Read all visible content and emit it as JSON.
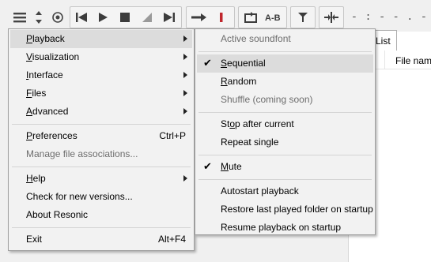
{
  "toolbar": {
    "position_text": "- : - - . -"
  },
  "panel": {
    "tab_label": "List",
    "column_header": "File name"
  },
  "main_menu": {
    "items": [
      {
        "key": "playback",
        "pre": "",
        "u": "P",
        "post": "layback",
        "has_submenu": true
      },
      {
        "key": "visualization",
        "pre": "",
        "u": "V",
        "post": "isualization",
        "has_submenu": true
      },
      {
        "key": "interface",
        "pre": "",
        "u": "I",
        "post": "nterface",
        "has_submenu": true
      },
      {
        "key": "files",
        "pre": "",
        "u": "F",
        "post": "iles",
        "has_submenu": true
      },
      {
        "key": "advanced",
        "pre": "",
        "u": "A",
        "post": "dvanced",
        "has_submenu": true
      },
      {
        "key": "preferences",
        "pre": "",
        "u": "P",
        "post": "references",
        "shortcut": "Ctrl+P"
      },
      {
        "key": "manage",
        "pre": "Manage file associations...",
        "u": "",
        "post": ""
      },
      {
        "key": "help",
        "pre": "",
        "u": "H",
        "post": "elp",
        "has_submenu": true
      },
      {
        "key": "check",
        "pre": "Check for new versions...",
        "u": "",
        "post": ""
      },
      {
        "key": "about",
        "pre": "About Resonic",
        "u": "",
        "post": ""
      },
      {
        "key": "exit",
        "pre": "Exit",
        "u": "",
        "post": "",
        "shortcut": "Alt+F4"
      }
    ]
  },
  "playback_menu": {
    "items": [
      {
        "key": "soundfont",
        "pre": "Active soundfont",
        "u": "",
        "post": ""
      },
      {
        "key": "sequential",
        "pre": "",
        "u": "S",
        "post": "equential",
        "checked": true
      },
      {
        "key": "random",
        "pre": "",
        "u": "R",
        "post": "andom"
      },
      {
        "key": "shuffle",
        "pre": "Shuffle (coming soon)",
        "u": "",
        "post": ""
      },
      {
        "key": "stop",
        "pre": "St",
        "u": "o",
        "post": "p after current"
      },
      {
        "key": "repeat",
        "pre": "Repeat single",
        "u": "",
        "post": ""
      },
      {
        "key": "mute",
        "pre": "",
        "u": "M",
        "post": "ute",
        "checked": true
      },
      {
        "key": "autostart",
        "pre": "Autostart playback",
        "u": "",
        "post": ""
      },
      {
        "key": "restore",
        "pre": "Restore last played folder on startup",
        "u": "",
        "post": ""
      },
      {
        "key": "resume",
        "pre": "Resume playback on startup",
        "u": "",
        "post": ""
      }
    ]
  },
  "colors": {
    "accent_red": "#c0262d",
    "icon_dark": "#3c3c3c"
  },
  "icons": [
    "hamburger-icon",
    "sort-arrows-icon",
    "target-icon",
    "previous-icon",
    "play-icon",
    "stop-icon",
    "slope-icon",
    "next-icon",
    "arrow-right-icon",
    "record-bar-icon",
    "repeat-icon",
    "ab-loop-icon",
    "filter-icon",
    "split-icon"
  ]
}
